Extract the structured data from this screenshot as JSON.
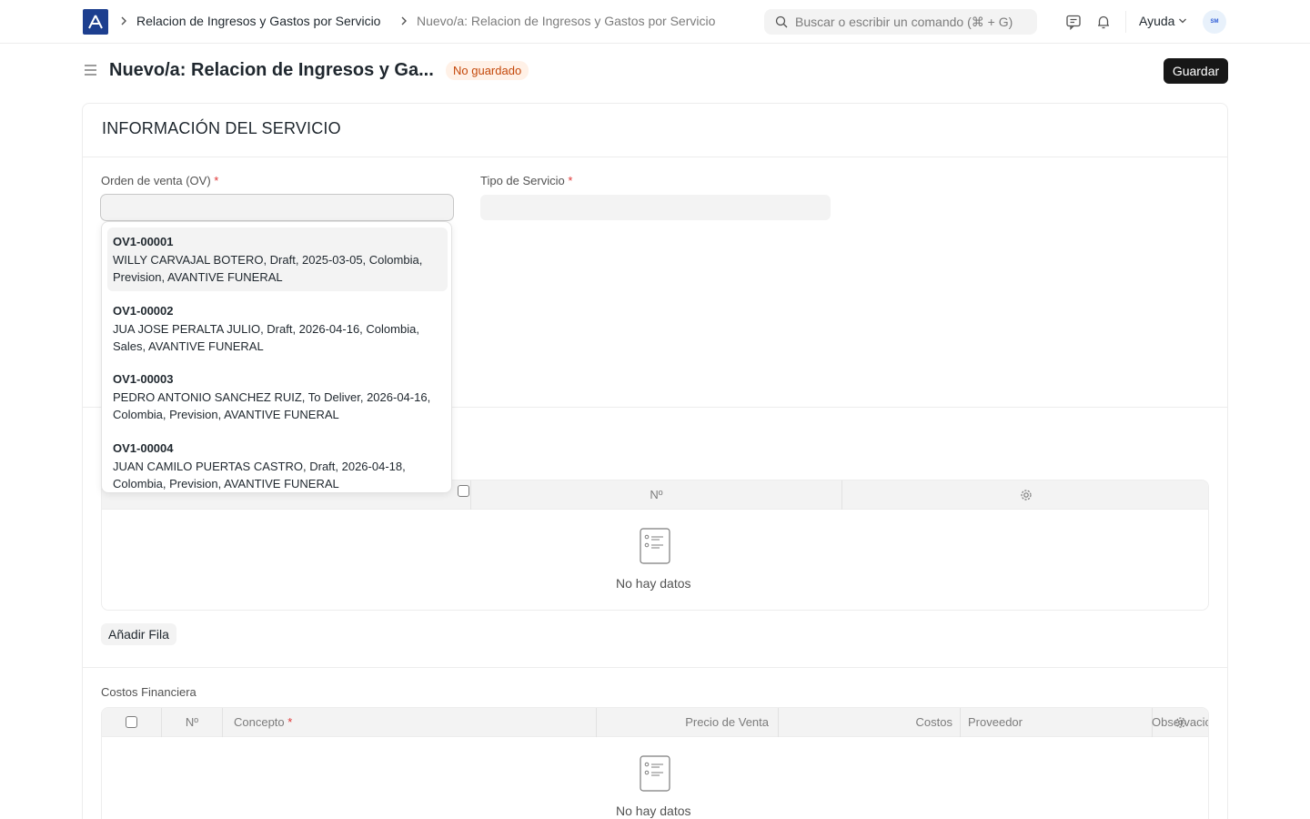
{
  "navbar": {
    "breadcrumbs": [
      "Relacion de Ingresos y Gastos por Servicio",
      "Nuevo/a: Relacion de Ingresos y Gastos por Servicio"
    ],
    "search_placeholder": "Buscar o escribir un comando (⌘ + G)",
    "help_label": "Ayuda",
    "avatar_text": "SM"
  },
  "header": {
    "title": "Nuevo/a: Relacion de Ingresos y Ga...",
    "status": "No guardado",
    "save_label": "Guardar"
  },
  "form": {
    "section_title": "INFORMACIÓN DEL SERVICIO",
    "order_label": "Orden de venta (OV)",
    "service_type_label": "Tipo de Servicio",
    "required_mark": "*"
  },
  "dropdown": {
    "items": [
      {
        "id": "OV1-00001",
        "desc": "WILLY CARVAJAL BOTERO, Draft, 2025-03-05, Colombia, Prevision, AVANTIVE FUNERAL"
      },
      {
        "id": "OV1-00002",
        "desc": "JUA JOSE PERALTA JULIO, Draft, 2026-04-16, Colombia, Sales, AVANTIVE FUNERAL"
      },
      {
        "id": "OV1-00003",
        "desc": "PEDRO ANTONIO SANCHEZ RUIZ, To Deliver, 2026-04-16, Colombia, Prevision, AVANTIVE FUNERAL"
      },
      {
        "id": "OV1-00004",
        "desc": "JUAN CAMILO PUERTAS CASTRO, Draft, 2026-04-18, Colombia, Prevision, AVANTIVE FUNERAL"
      }
    ]
  },
  "table1": {
    "col_no": "Nº",
    "empty_text": "No hay datos",
    "add_row_label": "Añadir Fila"
  },
  "table2": {
    "label": "Costos Financiera",
    "columns": {
      "no": "Nº",
      "concept": "Concepto",
      "sale_price": "Precio de Venta",
      "costs": "Costos",
      "provider": "Proveedor",
      "notes": "Observaciones"
    },
    "empty_text": "No hay datos"
  }
}
